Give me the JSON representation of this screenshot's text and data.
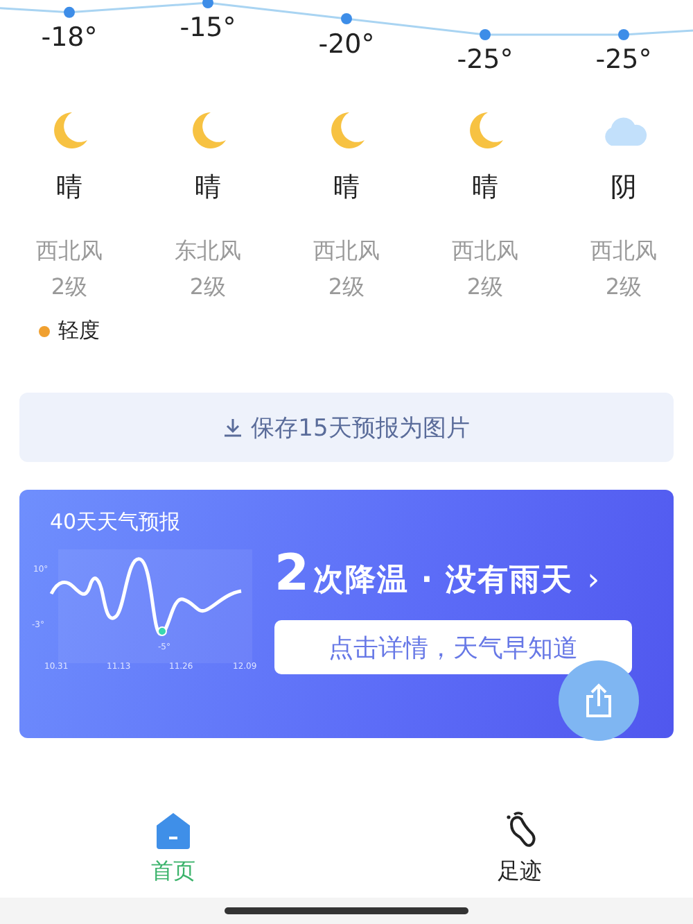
{
  "days": [
    {
      "temp": "-18°",
      "kind": "moon",
      "condition": "晴",
      "wind": "西北风",
      "wind_level": "2级"
    },
    {
      "temp": "-15°",
      "kind": "moon",
      "condition": "晴",
      "wind": "东北风",
      "wind_level": "2级"
    },
    {
      "temp": "-20°",
      "kind": "moon",
      "condition": "晴",
      "wind": "西北风",
      "wind_level": "2级"
    },
    {
      "temp": "-25°",
      "kind": "moon",
      "condition": "晴",
      "wind": "西北风",
      "wind_level": "2级"
    },
    {
      "temp": "-25°",
      "kind": "cloud",
      "condition": "阴",
      "wind": "西北风",
      "wind_level": "2级"
    }
  ],
  "air_legend": {
    "label": "轻度",
    "color": "#f0a030"
  },
  "save_card": {
    "label": "保存15天预报为图片"
  },
  "forecast_card": {
    "title": "40天天气预报",
    "y_ticks": [
      "10°",
      "-3°"
    ],
    "low_label": "-5°",
    "dates": [
      "10.31",
      "11.13",
      "11.26",
      "12.09"
    ],
    "headline_number": "2",
    "headline": "次降温 · 没有雨天",
    "chevron": "›",
    "button": "点击详情，天气早知道"
  },
  "bottom_nav": [
    {
      "label": "首页",
      "kind": "home",
      "selected": true
    },
    {
      "label": "足迹",
      "kind": "footprint",
      "selected": false
    }
  ]
}
